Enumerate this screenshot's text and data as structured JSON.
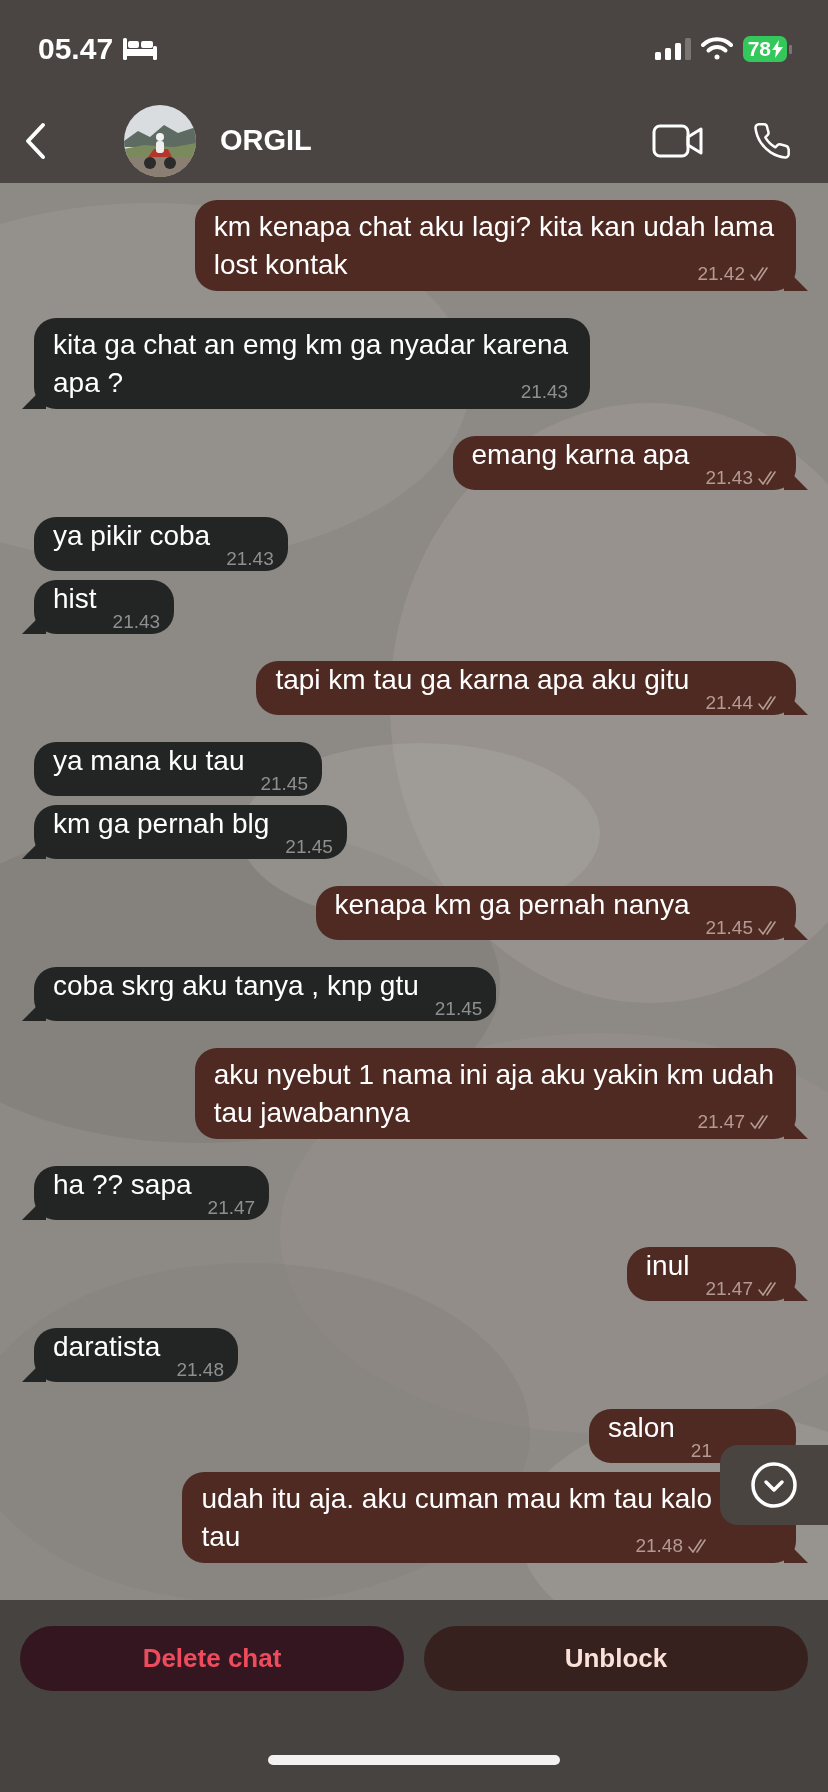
{
  "status_bar": {
    "time": "05.47",
    "battery": "78"
  },
  "header": {
    "contact": "ORGIL"
  },
  "messages": [
    {
      "outgoing": true,
      "lines": [
        "km kenapa chat aku lagi? kita kan udah lama",
        "lost kontak"
      ],
      "time": "21.42",
      "delivered": true
    },
    {
      "outgoing": false,
      "lines": [
        "kita ga chat an emg km ga nyadar karena",
        "apa ?"
      ],
      "time": "21.43"
    },
    {
      "outgoing": true,
      "lines": [
        "emang karna apa"
      ],
      "time": "21.43",
      "delivered": true
    },
    {
      "outgoing": false,
      "lines": [
        "ya pikir coba"
      ],
      "time": "21.43"
    },
    {
      "outgoing": false,
      "lines": [
        "hist"
      ],
      "time": "21.43"
    },
    {
      "outgoing": true,
      "lines": [
        "tapi km tau ga karna apa aku gitu"
      ],
      "time": "21.44",
      "delivered": true
    },
    {
      "outgoing": false,
      "lines": [
        "ya mana ku tau"
      ],
      "time": "21.45"
    },
    {
      "outgoing": false,
      "lines": [
        "km ga pernah blg"
      ],
      "time": "21.45"
    },
    {
      "outgoing": true,
      "lines": [
        "kenapa km ga pernah nanya"
      ],
      "time": "21.45",
      "delivered": true
    },
    {
      "outgoing": false,
      "lines": [
        "coba skrg aku tanya , knp gtu"
      ],
      "time": "21.45"
    },
    {
      "outgoing": true,
      "lines": [
        "aku nyebut 1 nama ini aja aku yakin km udah",
        "tau jawabannya"
      ],
      "time": "21.47",
      "delivered": true
    },
    {
      "outgoing": false,
      "lines": [
        "ha ?? sapa"
      ],
      "time": "21.47"
    },
    {
      "outgoing": true,
      "lines": [
        "inul"
      ],
      "time": "21.47",
      "delivered": true
    },
    {
      "outgoing": false,
      "lines": [
        "daratista"
      ],
      "time": "21.48"
    },
    {
      "outgoing": true,
      "lines": [
        "salon"
      ],
      "time": "21",
      "covered": true
    },
    {
      "outgoing": true,
      "lines": [
        "udah itu aja. aku cuman mau km tau kalo",
        "tau"
      ],
      "time": "21.48",
      "delivered": true,
      "covered": true
    }
  ],
  "actions": [
    {
      "label": "Delete chat",
      "kind": "danger"
    },
    {
      "label": "Unblock",
      "kind": "normal"
    }
  ]
}
